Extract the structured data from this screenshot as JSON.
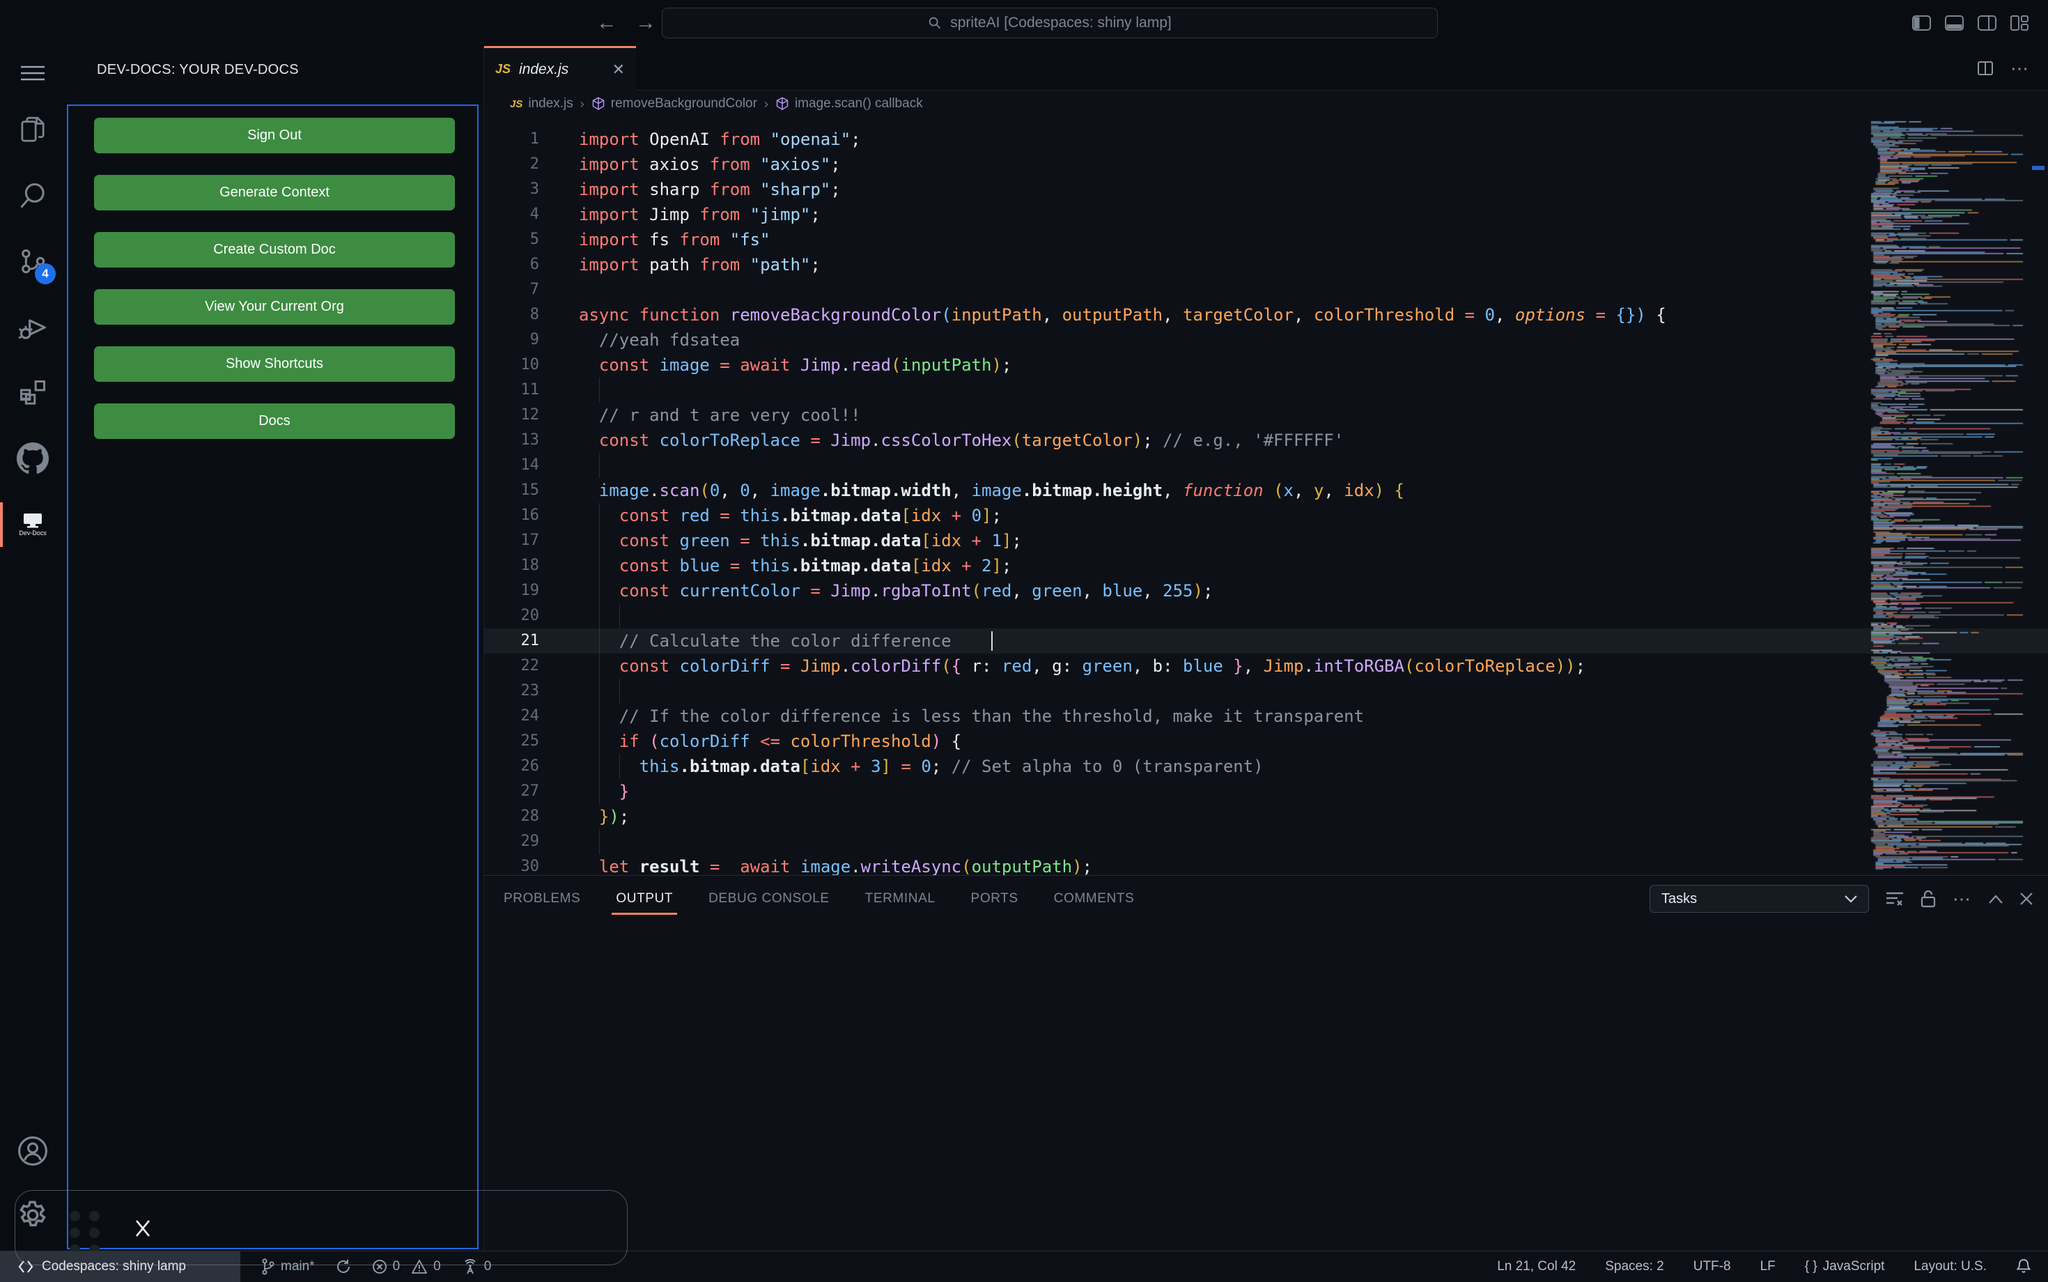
{
  "window": {
    "command_center": "spriteAI [Codespaces: shiny lamp]"
  },
  "activity_bar": {
    "badge": "4",
    "dev_docs_label": "Dev-Docs"
  },
  "sidebar": {
    "title": "DEV-DOCS: YOUR DEV-DOCS",
    "buttons": [
      "Sign Out",
      "Generate Context",
      "Create Custom Doc",
      "View Your Current Org",
      "Show Shortcuts",
      "Docs"
    ]
  },
  "editor": {
    "tab": {
      "badge": "JS",
      "label": "index.js",
      "close": "✕"
    },
    "breadcrumbs": [
      {
        "icon": "js",
        "label": "index.js"
      },
      {
        "icon": "symbol-cube",
        "label": "removeBackgroundColor"
      },
      {
        "icon": "symbol-cube",
        "label": "image.scan() callback"
      }
    ],
    "code": {
      "lines": [
        {
          "n": 1,
          "s": [
            [
              "k",
              "import "
            ],
            [
              "w",
              "OpenAI "
            ],
            [
              "k",
              "from "
            ],
            [
              "s",
              "\"openai\""
            ],
            [
              "w",
              ";"
            ]
          ]
        },
        {
          "n": 2,
          "s": [
            [
              "k",
              "import "
            ],
            [
              "w",
              "axios "
            ],
            [
              "k",
              "from "
            ],
            [
              "s",
              "\"axios\""
            ],
            [
              "w",
              ";"
            ]
          ]
        },
        {
          "n": 3,
          "s": [
            [
              "k",
              "import "
            ],
            [
              "w",
              "sharp "
            ],
            [
              "k",
              "from "
            ],
            [
              "s",
              "\"sharp\""
            ],
            [
              "w",
              ";"
            ]
          ]
        },
        {
          "n": 4,
          "s": [
            [
              "k",
              "import "
            ],
            [
              "w",
              "Jimp "
            ],
            [
              "k",
              "from "
            ],
            [
              "s",
              "\"jimp\""
            ],
            [
              "w",
              ";"
            ]
          ]
        },
        {
          "n": 5,
          "s": [
            [
              "k",
              "import "
            ],
            [
              "w",
              "fs "
            ],
            [
              "k",
              "from "
            ],
            [
              "s",
              "\"fs\""
            ]
          ]
        },
        {
          "n": 6,
          "s": [
            [
              "k",
              "import "
            ],
            [
              "w",
              "path "
            ],
            [
              "k",
              "from "
            ],
            [
              "s",
              "\"path\""
            ],
            [
              "w",
              ";"
            ]
          ]
        },
        {
          "n": 7,
          "s": []
        },
        {
          "n": 8,
          "s": [
            [
              "k",
              "async "
            ],
            [
              "k",
              "function "
            ],
            [
              "f",
              "removeBackgroundColor"
            ],
            [
              "c",
              "("
            ],
            [
              "p",
              "inputPath"
            ],
            [
              "w",
              ", "
            ],
            [
              "p",
              "outputPath"
            ],
            [
              "w",
              ", "
            ],
            [
              "p",
              "targetColor"
            ],
            [
              "w",
              ", "
            ],
            [
              "p",
              "colorThreshold"
            ],
            [
              "k",
              " = "
            ],
            [
              "c",
              "0"
            ],
            [
              "w",
              ", "
            ],
            [
              "pi",
              "options"
            ],
            [
              "k",
              " = "
            ],
            [
              "c",
              "{}"
            ],
            [
              "c",
              ")"
            ],
            [
              "w",
              " {"
            ]
          ]
        },
        {
          "n": 9,
          "s": [
            [
              "m",
              "  //yeah fdsatea"
            ]
          ]
        },
        {
          "n": 10,
          "s": [
            [
              "k",
              "  const "
            ],
            [
              "c",
              "image"
            ],
            [
              "k",
              " = "
            ],
            [
              "k",
              "await "
            ],
            [
              "f",
              "Jimp"
            ],
            [
              "w",
              "."
            ],
            [
              "f",
              "read"
            ],
            [
              "y",
              "("
            ],
            [
              "g",
              "inputPath"
            ],
            [
              "y",
              ")"
            ],
            [
              "w",
              ";"
            ]
          ]
        },
        {
          "n": 11,
          "s": [],
          "g": [
            2
          ]
        },
        {
          "n": 12,
          "s": [
            [
              "m",
              "  // r and t are very cool!!"
            ]
          ]
        },
        {
          "n": 13,
          "s": [
            [
              "k",
              "  const "
            ],
            [
              "c",
              "colorToReplace"
            ],
            [
              "k",
              " = "
            ],
            [
              "f",
              "Jimp"
            ],
            [
              "w",
              "."
            ],
            [
              "f",
              "cssColorToHex"
            ],
            [
              "y",
              "("
            ],
            [
              "p",
              "targetColor"
            ],
            [
              "y",
              ")"
            ],
            [
              "w",
              "; "
            ],
            [
              "m",
              "// e.g., '#FFFFFF'"
            ]
          ]
        },
        {
          "n": 14,
          "s": [],
          "g": [
            2
          ]
        },
        {
          "n": 15,
          "s": [
            [
              "c",
              "  image"
            ],
            [
              "w",
              "."
            ],
            [
              "f",
              "scan"
            ],
            [
              "y",
              "("
            ],
            [
              "c",
              "0"
            ],
            [
              "w",
              ", "
            ],
            [
              "c",
              "0"
            ],
            [
              "w",
              ", "
            ],
            [
              "c",
              "image"
            ],
            [
              "b",
              ".bitmap.width"
            ],
            [
              "w",
              ", "
            ],
            [
              "c",
              "image"
            ],
            [
              "b",
              ".bitmap.height"
            ],
            [
              "w",
              ", "
            ],
            [
              "ki",
              "function "
            ],
            [
              "y",
              "("
            ],
            [
              "c",
              "x"
            ],
            [
              "w",
              ", "
            ],
            [
              "y",
              "y"
            ],
            [
              "w",
              ", "
            ],
            [
              "p",
              "idx"
            ],
            [
              "y",
              ")"
            ],
            [
              "y",
              " {"
            ]
          ]
        },
        {
          "n": 16,
          "s": [
            [
              "k",
              "    const "
            ],
            [
              "c",
              "red"
            ],
            [
              "k",
              " = "
            ],
            [
              "c",
              "this"
            ],
            [
              "b",
              ".bitmap.data"
            ],
            [
              "y",
              "["
            ],
            [
              "p",
              "idx"
            ],
            [
              "k",
              " + "
            ],
            [
              "c",
              "0"
            ],
            [
              "y",
              "]"
            ],
            [
              "w",
              ";"
            ]
          ],
          "g": [
            2
          ]
        },
        {
          "n": 17,
          "s": [
            [
              "k",
              "    const "
            ],
            [
              "c",
              "green"
            ],
            [
              "k",
              " = "
            ],
            [
              "c",
              "this"
            ],
            [
              "b",
              ".bitmap.data"
            ],
            [
              "y",
              "["
            ],
            [
              "p",
              "idx"
            ],
            [
              "k",
              " + "
            ],
            [
              "c",
              "1"
            ],
            [
              "y",
              "]"
            ],
            [
              "w",
              ";"
            ]
          ],
          "g": [
            2
          ]
        },
        {
          "n": 18,
          "s": [
            [
              "k",
              "    const "
            ],
            [
              "c",
              "blue"
            ],
            [
              "k",
              " = "
            ],
            [
              "c",
              "this"
            ],
            [
              "b",
              ".bitmap.data"
            ],
            [
              "y",
              "["
            ],
            [
              "p",
              "idx"
            ],
            [
              "k",
              " + "
            ],
            [
              "c",
              "2"
            ],
            [
              "y",
              "]"
            ],
            [
              "w",
              ";"
            ]
          ],
          "g": [
            2
          ]
        },
        {
          "n": 19,
          "s": [
            [
              "k",
              "    const "
            ],
            [
              "c",
              "currentColor"
            ],
            [
              "k",
              " = "
            ],
            [
              "f",
              "Jimp"
            ],
            [
              "w",
              "."
            ],
            [
              "f",
              "rgbaToInt"
            ],
            [
              "y",
              "("
            ],
            [
              "c",
              "red"
            ],
            [
              "w",
              ", "
            ],
            [
              "c",
              "green"
            ],
            [
              "w",
              ", "
            ],
            [
              "c",
              "blue"
            ],
            [
              "w",
              ", "
            ],
            [
              "c",
              "255"
            ],
            [
              "y",
              ")"
            ],
            [
              "w",
              ";"
            ]
          ],
          "g": [
            2
          ]
        },
        {
          "n": 20,
          "s": [],
          "g": [
            2,
            4
          ]
        },
        {
          "n": 21,
          "s": [
            [
              "m",
              "    // Calculate the color difference"
            ]
          ],
          "g": [
            2
          ],
          "hl": true,
          "cursor": 41
        },
        {
          "n": 22,
          "s": [
            [
              "k",
              "    const "
            ],
            [
              "c",
              "colorDiff"
            ],
            [
              "k",
              " = "
            ],
            [
              "p",
              "Jimp"
            ],
            [
              "w",
              "."
            ],
            [
              "f",
              "colorDiff"
            ],
            [
              "y",
              "("
            ],
            [
              "pk",
              "{ "
            ],
            [
              "w",
              "r: "
            ],
            [
              "c",
              "red"
            ],
            [
              "w",
              ", g: "
            ],
            [
              "c",
              "green"
            ],
            [
              "w",
              ", b: "
            ],
            [
              "c",
              "blue"
            ],
            [
              "pk",
              " }"
            ],
            [
              "w",
              ", "
            ],
            [
              "p",
              "Jimp"
            ],
            [
              "w",
              "."
            ],
            [
              "f",
              "intToRGBA"
            ],
            [
              "y",
              "("
            ],
            [
              "p",
              "colorToReplace"
            ],
            [
              "y",
              "))"
            ],
            [
              "w",
              ";"
            ]
          ],
          "g": [
            2
          ]
        },
        {
          "n": 23,
          "s": [],
          "g": [
            2,
            4
          ]
        },
        {
          "n": 24,
          "s": [
            [
              "m",
              "    // If the color difference is less than the threshold, make it transparent"
            ]
          ],
          "g": [
            2
          ]
        },
        {
          "n": 25,
          "s": [
            [
              "k",
              "    if "
            ],
            [
              "pk",
              "("
            ],
            [
              "c",
              "colorDiff"
            ],
            [
              "k",
              " <= "
            ],
            [
              "p",
              "colorThreshold"
            ],
            [
              "pk",
              ")"
            ],
            [
              "w",
              " {"
            ]
          ],
          "g": [
            2
          ]
        },
        {
          "n": 26,
          "s": [
            [
              "c",
              "      this"
            ],
            [
              "b",
              ".bitmap.data"
            ],
            [
              "y",
              "["
            ],
            [
              "p",
              "idx"
            ],
            [
              "k",
              " + "
            ],
            [
              "c",
              "3"
            ],
            [
              "y",
              "]"
            ],
            [
              "k",
              " = "
            ],
            [
              "c",
              "0"
            ],
            [
              "w",
              "; "
            ],
            [
              "m",
              "// Set alpha to 0 (transparent)"
            ]
          ],
          "g": [
            2,
            4
          ]
        },
        {
          "n": 27,
          "s": [
            [
              "pk",
              "    }"
            ]
          ],
          "g": [
            2
          ]
        },
        {
          "n": 28,
          "s": [
            [
              "y",
              "  }"
            ],
            [
              "g",
              ")"
            ],
            [
              "w",
              ";"
            ]
          ]
        },
        {
          "n": 29,
          "s": [],
          "g": [
            2
          ]
        },
        {
          "n": 30,
          "s": [
            [
              "k",
              "  let "
            ],
            [
              "b",
              "result"
            ],
            [
              "k",
              " = "
            ],
            [
              "k",
              " await "
            ],
            [
              "c",
              "image"
            ],
            [
              "w",
              "."
            ],
            [
              "f",
              "writeAsync"
            ],
            [
              "y",
              "("
            ],
            [
              "g",
              "outputPath"
            ],
            [
              "y",
              ")"
            ],
            [
              "w",
              ";"
            ]
          ]
        }
      ]
    }
  },
  "panel": {
    "tabs": [
      "PROBLEMS",
      "OUTPUT",
      "DEBUG CONSOLE",
      "TERMINAL",
      "PORTS",
      "COMMENTS"
    ],
    "active_tab": "OUTPUT",
    "tasks_dropdown": "Tasks"
  },
  "status_bar": {
    "remote": "Codespaces: shiny lamp",
    "branch": "main*",
    "errors": "0",
    "warnings": "0",
    "ports": "0",
    "line_col": "Ln 21, Col 42",
    "indent": "Spaces: 2",
    "encoding": "UTF-8",
    "eol": "LF",
    "language": "JavaScript",
    "language_icon": "{ }",
    "layout": "Layout: U.S."
  },
  "colors": {
    "accent_orange": "#f78166",
    "focus_blue": "#2266e3",
    "button_green": "#3d8c42",
    "badge_blue": "#1f6feb",
    "editor_bg": "#0d1117",
    "chrome_bg": "#090d12"
  }
}
